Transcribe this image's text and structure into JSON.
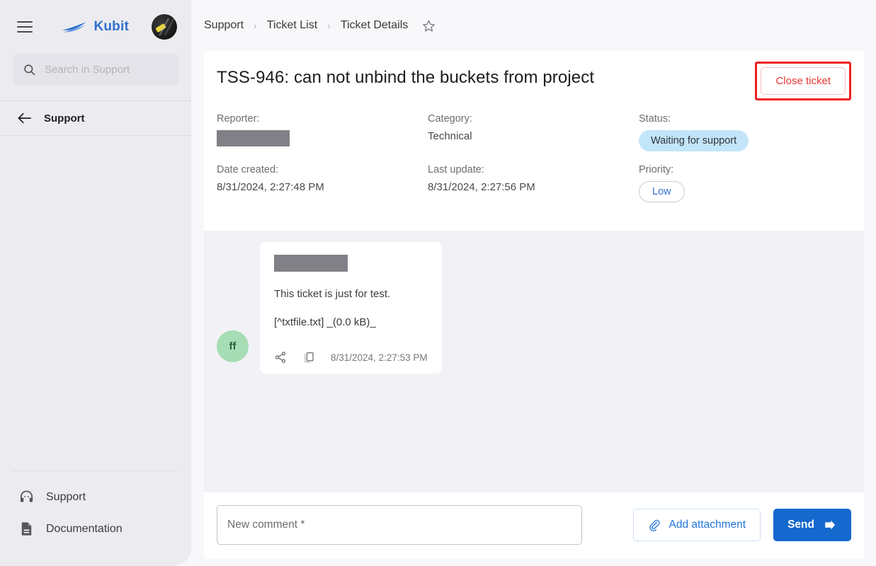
{
  "sidebar": {
    "brand": {
      "name": "Kubit",
      "logo_icon": "kubit-swoosh-logo",
      "color": "#2f6fd0"
    },
    "menu_icon": "hamburger-menu-icon",
    "user_avatar_icon": "user-avatar-image",
    "search": {
      "placeholder": "Search in Support",
      "icon": "search-icon"
    },
    "back_item": {
      "label": "Support",
      "icon": "arrow-left-icon"
    },
    "bottom_links": [
      {
        "label": "Support",
        "icon": "headset-support-icon"
      },
      {
        "label": "Documentation",
        "icon": "document-icon"
      }
    ]
  },
  "breadcrumb": {
    "items": [
      "Support",
      "Ticket List",
      "Ticket Details"
    ],
    "separator": "›",
    "favorite_icon": "star-outline-icon"
  },
  "ticket": {
    "title": "TSS-946: can not unbind the buckets from project",
    "close_button": {
      "label": "Close ticket",
      "border_color": "#ef2020",
      "text_color": "#e53935"
    },
    "fields": {
      "reporter_label": "Reporter:",
      "reporter_value": "",
      "category_label": "Category:",
      "category_value": "Technical",
      "status_label": "Status:",
      "status_value": "Waiting for support",
      "status_color": "#c2e5fa",
      "date_created_label": "Date created:",
      "date_created_value": "8/31/2024, 2:27:48 PM",
      "last_update_label": "Last update:",
      "last_update_value": "8/31/2024, 2:27:56 PM",
      "priority_label": "Priority:",
      "priority_value": "Low",
      "priority_color": "#2f6fd0"
    }
  },
  "conversation": {
    "messages": [
      {
        "avatar_initials": "ff",
        "avatar_color": "#a7ddb5",
        "author_value": "",
        "text": "This ticket is just for test.",
        "attachment": "[^txtfile.txt] _(0.0 kB)_",
        "timestamp": "8/31/2024, 2:27:53 PM",
        "share_icon": "share-icon",
        "copy_icon": "copy-icon"
      }
    ]
  },
  "composer": {
    "comment_placeholder": "New comment *",
    "attach_button": {
      "label": "Add attachment",
      "icon": "paperclip-icon"
    },
    "send_button": {
      "label": "Send",
      "icon": "send-arrow-icon",
      "color": "#1568ce"
    }
  }
}
